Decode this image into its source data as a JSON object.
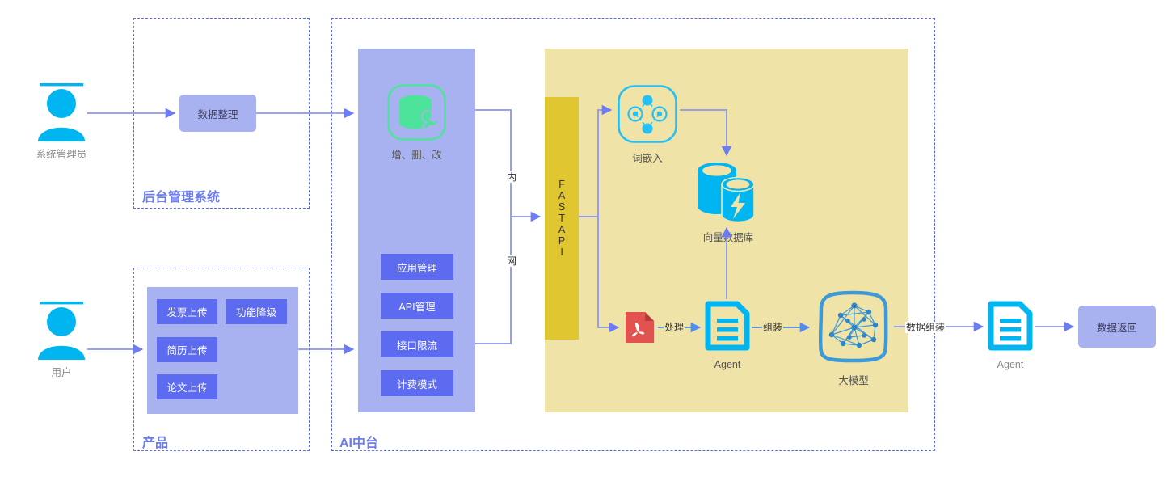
{
  "diagram": {
    "title_hint": "AI platform architecture",
    "colors": {
      "accent_purple": "#5c6bf0",
      "soft_purple": "#a8b2f0",
      "yellow_region": "#efe3a8",
      "fastapi_yellow": "#e0c732",
      "cyan": "#00b5f0",
      "green": "#4ee39b",
      "pdf_red": "#e2524f",
      "llm_blue": "#3d9ad8",
      "label_gray": "#8a8a8a"
    },
    "actors": [
      {
        "id": "admin",
        "label": "系统管理员",
        "icon": "user-admin-icon"
      },
      {
        "id": "user",
        "label": "用户",
        "icon": "user-icon"
      }
    ],
    "groups": [
      {
        "id": "backend",
        "label": "后台管理系统"
      },
      {
        "id": "product",
        "label": "产品"
      },
      {
        "id": "ai-platform",
        "label": "AI中台"
      }
    ],
    "backend": {
      "node": {
        "label": "数据整理"
      }
    },
    "product": {
      "features": [
        {
          "label": "发票上传"
        },
        {
          "label": "功能降级"
        },
        {
          "label": "简历上传"
        },
        {
          "label": "论文上传"
        }
      ]
    },
    "platform": {
      "crud": {
        "icon": "database-wrench-icon",
        "caption": "增、删、改"
      },
      "services": [
        {
          "label": "应用管理"
        },
        {
          "label": "API管理"
        },
        {
          "label": "接口限流"
        },
        {
          "label": "计费模式"
        }
      ],
      "network_label_chars": [
        "内",
        "网"
      ],
      "gateway": {
        "label_chars": [
          "F",
          "A",
          "S",
          "T",
          "A",
          "P",
          "I"
        ],
        "label": "FASTAPI"
      }
    },
    "rag": {
      "embedding": {
        "icon": "word-embedding-icon",
        "caption": "词嵌入"
      },
      "vector_db": {
        "icon": "vector-database-icon",
        "caption": "向量数据库"
      },
      "pdf": {
        "icon": "pdf-file-icon",
        "caption": ""
      },
      "agent": {
        "icon": "agent-document-icon",
        "caption": "Agent"
      },
      "llm": {
        "icon": "large-model-icon",
        "caption": "大模型"
      },
      "edges": [
        {
          "label": "处理"
        },
        {
          "label": "组装"
        }
      ]
    },
    "output": {
      "edge_label": "数据组装",
      "agent": {
        "icon": "agent-document-icon",
        "caption": "Agent"
      },
      "result": {
        "label": "数据返回"
      }
    }
  }
}
